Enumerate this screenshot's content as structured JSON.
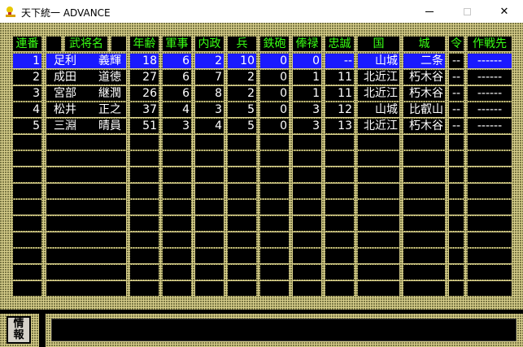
{
  "window": {
    "title": "天下統一 ADVANCE",
    "minimize_glyph": "—",
    "close_glyph": "✕"
  },
  "headers": [
    "連番",
    "",
    "武将名",
    "",
    "年齢",
    "軍事",
    "内政",
    "兵",
    "鉄砲",
    "俸禄",
    "忠誠",
    "国",
    "城",
    "令",
    "作戦先"
  ],
  "rows": [
    {
      "no": "1",
      "surname": "足利",
      "given": "義輝",
      "age": "18",
      "mil": "6",
      "adm": "2",
      "troops": "10",
      "guns": "0",
      "stipend": "0",
      "loyalty": "--",
      "province": "山城",
      "castle": "二条",
      "order": "--",
      "target": "------",
      "selected": true
    },
    {
      "no": "2",
      "surname": "成田",
      "given": "道徳",
      "age": "27",
      "mil": "6",
      "adm": "7",
      "troops": "2",
      "guns": "0",
      "stipend": "1",
      "loyalty": "11",
      "province": "北近江",
      "castle": "朽木谷",
      "order": "--",
      "target": "------",
      "selected": false
    },
    {
      "no": "3",
      "surname": "宮部",
      "given": "継潤",
      "age": "26",
      "mil": "6",
      "adm": "8",
      "troops": "2",
      "guns": "0",
      "stipend": "1",
      "loyalty": "11",
      "province": "北近江",
      "castle": "朽木谷",
      "order": "--",
      "target": "------",
      "selected": false
    },
    {
      "no": "4",
      "surname": "松井",
      "given": "正之",
      "age": "37",
      "mil": "4",
      "adm": "3",
      "troops": "5",
      "guns": "0",
      "stipend": "3",
      "loyalty": "12",
      "province": "山城",
      "castle": "比叡山",
      "order": "--",
      "target": "------",
      "selected": false
    },
    {
      "no": "5",
      "surname": "三淵",
      "given": "晴員",
      "age": "51",
      "mil": "3",
      "adm": "4",
      "troops": "5",
      "guns": "0",
      "stipend": "3",
      "loyalty": "13",
      "province": "北近江",
      "castle": "朽木谷",
      "order": "--",
      "target": "------",
      "selected": false
    }
  ],
  "empty_rows": 10,
  "info_button": {
    "line1": "情",
    "line2": "報"
  },
  "colors": {
    "header_text": "#39ff14",
    "cell_bg": "#000000",
    "selected_bg": "#1a1aff",
    "board_bg": "#d8cf8c"
  }
}
